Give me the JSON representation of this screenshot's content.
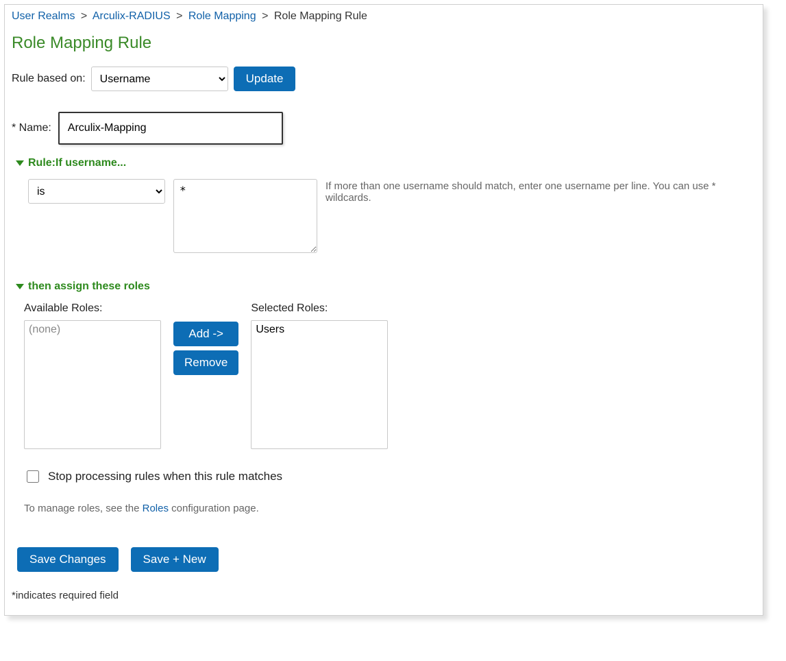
{
  "breadcrumb": {
    "items": [
      {
        "label": "User Realms",
        "link": true
      },
      {
        "label": "Arculix-RADIUS",
        "link": true
      },
      {
        "label": "Role Mapping",
        "link": true
      }
    ],
    "current": "Role Mapping Rule",
    "sep": ">"
  },
  "page_title": "Role Mapping Rule",
  "rule_basis": {
    "label": "Rule based on:",
    "selected": "Username",
    "update_label": "Update"
  },
  "name": {
    "label": "* Name:",
    "value": "Arculix-Mapping"
  },
  "rule_section": {
    "heading": "Rule:If username...",
    "condition_selected": "is",
    "match_value": "*",
    "hint": "If more than one username should match, enter one username per line. You can use * wildcards."
  },
  "assign_section": {
    "heading": "then assign these roles",
    "available_label": "Available Roles:",
    "available_placeholder": "(none)",
    "available_items": [],
    "selected_label": "Selected Roles:",
    "selected_items": [
      "Users"
    ],
    "add_label": "Add ->",
    "remove_label": "Remove",
    "stop_label": "Stop processing rules when this rule matches",
    "stop_checked": false,
    "manage_note_pre": "To manage roles, see the ",
    "manage_note_link": "Roles",
    "manage_note_post": " configuration page."
  },
  "footer": {
    "save_label": "Save Changes",
    "save_new_label": "Save + New",
    "required_note": "*indicates required field"
  }
}
